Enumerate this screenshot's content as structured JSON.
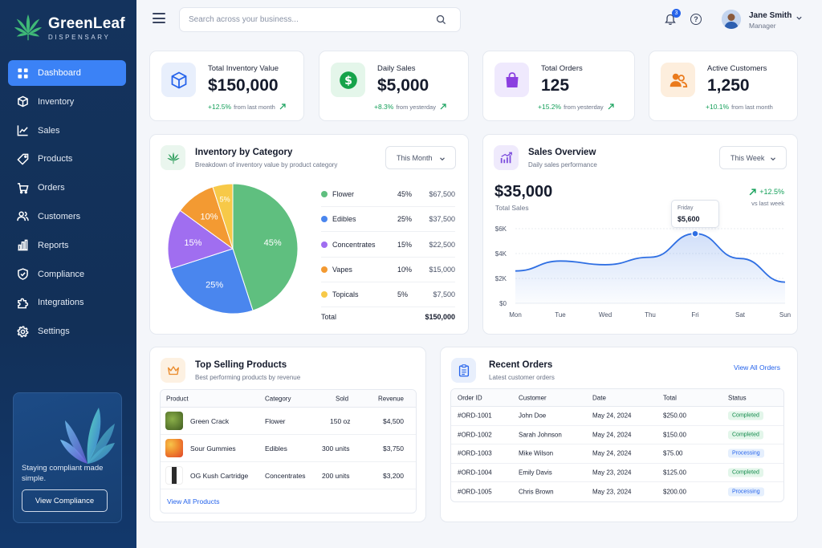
{
  "brand": {
    "name": "GreenLeaf",
    "sub": "DISPENSARY"
  },
  "nav": [
    {
      "label": "Dashboard",
      "icon": "dashboard-icon",
      "active": true
    },
    {
      "label": "Inventory",
      "icon": "box-icon"
    },
    {
      "label": "Sales",
      "icon": "chart-line-icon"
    },
    {
      "label": "Products",
      "icon": "tag-icon"
    },
    {
      "label": "Orders",
      "icon": "cart-icon"
    },
    {
      "label": "Customers",
      "icon": "users-icon"
    },
    {
      "label": "Reports",
      "icon": "bar-chart-icon"
    },
    {
      "label": "Compliance",
      "icon": "shield-icon"
    },
    {
      "label": "Integrations",
      "icon": "puzzle-icon"
    },
    {
      "label": "Settings",
      "icon": "gear-icon"
    }
  ],
  "promo": {
    "text": "Staying compliant made simple.",
    "button": "View Compliance"
  },
  "search": {
    "placeholder": "Search across your business..."
  },
  "notifications": {
    "count": "3"
  },
  "user": {
    "name": "Jane Smith",
    "role": "Manager"
  },
  "stats": [
    {
      "label": "Total Inventory Value",
      "value": "$150,000",
      "trend": "+12.5%",
      "period": "from last month",
      "icon": "cube-icon",
      "color": "#2563eb",
      "bg": "#e8effc"
    },
    {
      "label": "Daily Sales",
      "value": "$5,000",
      "trend": "+8.3%",
      "period": "from yesterday",
      "icon": "dollar-icon",
      "color": "#16a34a",
      "bg": "#e4f6ea"
    },
    {
      "label": "Total Orders",
      "value": "125",
      "trend": "+15.2%",
      "period": "from yesterday",
      "icon": "shopping-bag-icon",
      "color": "#7c3aed",
      "bg": "#efe9fd"
    },
    {
      "label": "Active Customers",
      "value": "1,250",
      "trend": "+10.1%",
      "period": "from last month",
      "icon": "customers-icon",
      "color": "#ea7a1c",
      "bg": "#fdeedd"
    }
  ],
  "inventory": {
    "title": "Inventory by Category",
    "subtitle": "Breakdown of inventory value by product category",
    "period": "This Month",
    "total_label": "Total",
    "total_value": "$150,000"
  },
  "sales": {
    "title": "Sales Overview",
    "subtitle": "Daily sales performance",
    "period": "This Week",
    "total": "$35,000",
    "total_label": "Total Sales",
    "trend": "+12.5%",
    "trend_label": "vs last week",
    "tooltip_day": "Friday",
    "tooltip_value": "$5,600"
  },
  "chart_data": [
    {
      "type": "pie",
      "categories": [
        "Flower",
        "Edibles",
        "Concentrates",
        "Vapes",
        "Topicals"
      ],
      "values": [
        45,
        25,
        15,
        10,
        5
      ],
      "labels": [
        "45%",
        "25%",
        "15%",
        "10%",
        "5%"
      ],
      "amounts": [
        "$67,500",
        "$37,500",
        "$22,500",
        "$15,000",
        "$7,500"
      ],
      "colors": [
        "#5fbf7f",
        "#4a86ee",
        "#a06ef0",
        "#f39a32",
        "#f7c948"
      ]
    },
    {
      "type": "area",
      "x": [
        "Mon",
        "Tue",
        "Wed",
        "Thu",
        "Fri",
        "Sat",
        "Sun"
      ],
      "y": [
        2600,
        3400,
        3100,
        3700,
        5600,
        3600,
        1700
      ],
      "y_ticks": [
        "$0",
        "$2K",
        "$4K",
        "$6K"
      ],
      "ylim": [
        0,
        6000
      ],
      "color": "#2f6fe3"
    }
  ],
  "top_products": {
    "title": "Top Selling Products",
    "subtitle": "Best performing products by revenue",
    "headers": [
      "Product",
      "Category",
      "Sold",
      "Revenue"
    ],
    "rows": [
      {
        "name": "Green Crack",
        "category": "Flower",
        "sold": "150 oz",
        "revenue": "$4,500"
      },
      {
        "name": "Sour Gummies",
        "category": "Edibles",
        "sold": "300 units",
        "revenue": "$3,750"
      },
      {
        "name": "OG Kush Cartridge",
        "category": "Concentrates",
        "sold": "200 units",
        "revenue": "$3,200"
      }
    ],
    "link": "View All Products"
  },
  "recent_orders": {
    "title": "Recent Orders",
    "subtitle": "Latest customer orders",
    "link": "View All Orders",
    "headers": [
      "Order ID",
      "Customer",
      "Date",
      "Total",
      "Status"
    ],
    "rows": [
      {
        "id": "#ORD-1001",
        "customer": "John Doe",
        "date": "May 24, 2024",
        "total": "$250.00",
        "status": "Completed"
      },
      {
        "id": "#ORD-1002",
        "customer": "Sarah Johnson",
        "date": "May 24, 2024",
        "total": "$150.00",
        "status": "Completed"
      },
      {
        "id": "#ORD-1003",
        "customer": "Mike Wilson",
        "date": "May 24, 2024",
        "total": "$75.00",
        "status": "Processing"
      },
      {
        "id": "#ORD-1004",
        "customer": "Emily Davis",
        "date": "May 23, 2024",
        "total": "$125.00",
        "status": "Completed"
      },
      {
        "id": "#ORD-1005",
        "customer": "Chris Brown",
        "date": "May 23, 2024",
        "total": "$200.00",
        "status": "Processing"
      }
    ]
  }
}
